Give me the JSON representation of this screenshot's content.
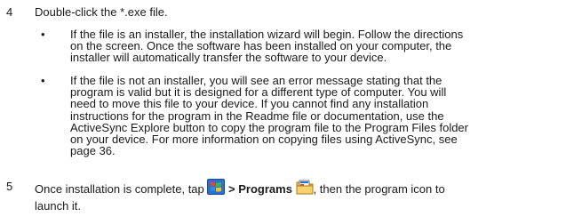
{
  "steps": [
    {
      "number": "4",
      "text": "Double-click the *.exe file.",
      "bullets": [
        {
          "dot": "•",
          "lines": [
            "If the file is an installer, the installation wizard will begin. Follow the directions",
            "on the screen. Once the software has been installed on your computer, the",
            "installer will automatically transfer the software to your device."
          ]
        },
        {
          "dot": "•",
          "lines": [
            "If the file is not an installer, you will see an error message stating that the",
            "program is valid but it is designed for a different type of computer. You will",
            "need to move this file to your device. If you cannot find any installation",
            "instructions for the program in the Readme file or documentation, use the",
            "ActiveSync Explore button to copy the program file to the Program Files folder",
            "on your device. For more information on copying files using ActiveSync, see",
            "page 36."
          ]
        }
      ]
    },
    {
      "number": "5",
      "text_before": "Once installation is complete, tap",
      "separator": ">",
      "programs_label": "Programs",
      "text_after": ", then the program icon to",
      "line2": "launch it.",
      "icons": [
        "windows-start-icon",
        "programs-folder-icon"
      ]
    }
  ]
}
